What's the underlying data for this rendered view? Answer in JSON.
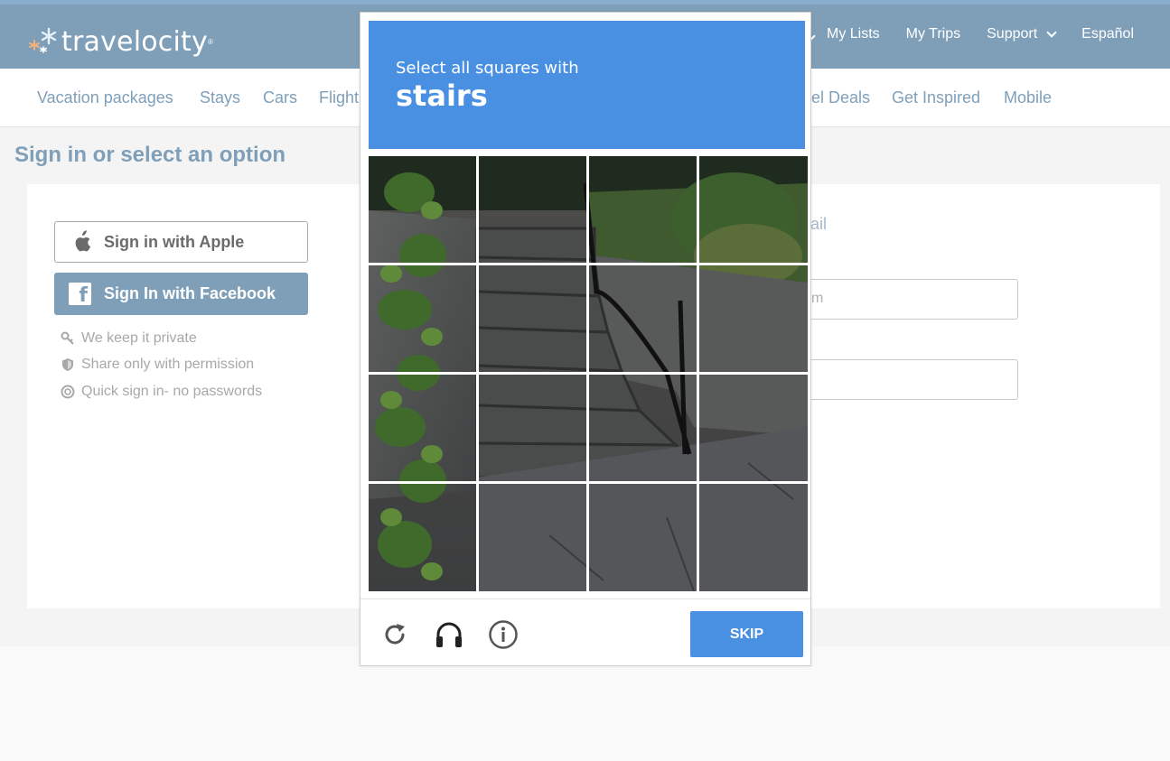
{
  "brand": {
    "name": "travelocity",
    "reg": "®"
  },
  "topnav": {
    "items": [
      {
        "label": "My Lists"
      },
      {
        "label": "My Trips"
      },
      {
        "label": "Support"
      },
      {
        "label": "Español"
      }
    ]
  },
  "subnav": {
    "items": [
      {
        "label": "Vacation packages"
      },
      {
        "label": "Stays"
      },
      {
        "label": "Cars"
      },
      {
        "label": "Flight"
      },
      {
        "label": "el Deals"
      },
      {
        "label": "Get Inspired"
      },
      {
        "label": "Mobile"
      }
    ]
  },
  "page": {
    "title": "Sign in or select an option"
  },
  "signin": {
    "apple_label": "Sign in with Apple",
    "facebook_label": "Sign In with Facebook",
    "perks": [
      {
        "label": "We keep it private",
        "icon": "key-icon"
      },
      {
        "label": "Share only with permission",
        "icon": "shield-icon"
      },
      {
        "label": "Quick sign in- no passwords",
        "icon": "quick-signin-icon"
      }
    ]
  },
  "email_panel": {
    "label_partial": "ail",
    "email_placeholder_partial": "m",
    "password_placeholder_partial": ""
  },
  "captcha": {
    "instruction": "Select all squares with",
    "target": "stairs",
    "grid": {
      "rows": 4,
      "cols": 4
    },
    "skip_label": "SKIP",
    "icons": [
      "reload-icon",
      "audio-icon",
      "info-icon"
    ],
    "accent_color": "#4a90e2"
  },
  "colors": {
    "header": "#7f9fb9",
    "nav_text": "#7f9fb9",
    "captcha_blue": "#4a90e2"
  }
}
